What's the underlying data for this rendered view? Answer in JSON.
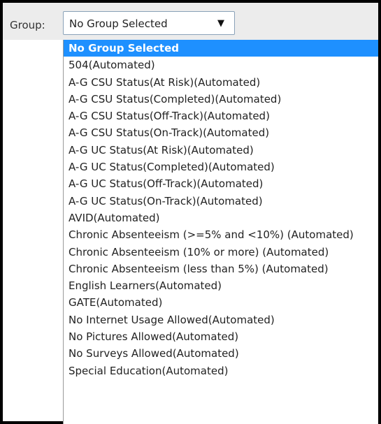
{
  "group": {
    "label": "Group:",
    "selected_value": "No Group Selected",
    "arrow": "▼"
  },
  "dropdown": {
    "options": [
      "No Group Selected",
      "504(Automated)",
      "A-G CSU Status(At Risk)(Automated)",
      "A-G CSU Status(Completed)(Automated)",
      "A-G CSU Status(Off-Track)(Automated)",
      "A-G CSU Status(On-Track)(Automated)",
      "A-G UC Status(At Risk)(Automated)",
      "A-G UC Status(Completed)(Automated)",
      "A-G UC Status(Off-Track)(Automated)",
      "A-G UC Status(On-Track)(Automated)",
      "AVID(Automated)",
      "Chronic Absenteeism (>=5% and <10%) (Automated)",
      "Chronic Absenteeism (10% or more) (Automated)",
      "Chronic Absenteeism (less than 5%) (Automated)",
      "English Learners(Automated)",
      "GATE(Automated)",
      "No Internet Usage Allowed(Automated)",
      "No Pictures Allowed(Automated)",
      "No Surveys Allowed(Automated)",
      "Special Education(Automated)"
    ],
    "selected_index": 0,
    "highlight_color": "#1e90ff"
  }
}
